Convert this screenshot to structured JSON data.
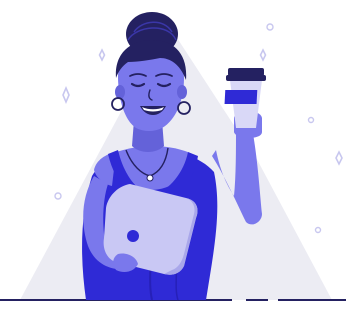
{
  "illustration": {
    "subject": "woman-holding-coffee-and-laptop",
    "icons": [
      "sparkle-icon",
      "circle-icon",
      "coffee-cup-icon",
      "laptop-icon",
      "triangle-backdrop-icon"
    ]
  },
  "colors": {
    "background": "#ffffff",
    "backdrop_triangle": "#ececf3",
    "skin": "#7a78ec",
    "skin_shadow": "#6462d9",
    "hair": "#242161",
    "dress": "#2f2ad6",
    "dress_dark": "#2620b8",
    "laptop": "#c9c8f4",
    "laptop_edge": "#a9a7ea",
    "cup_body": "#d9d8f7",
    "cup_lid": "#242161",
    "cup_sleeve": "#2f2ad6",
    "sparkle": "#c8c7ef",
    "ground_line": "#242161",
    "mouth": "#ffffff"
  }
}
